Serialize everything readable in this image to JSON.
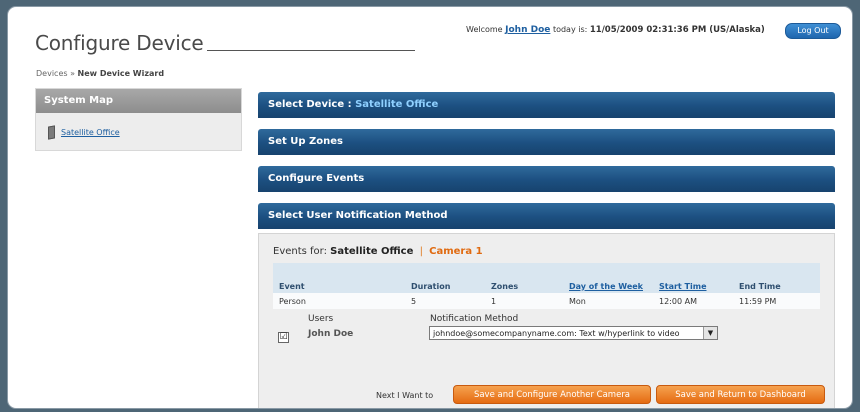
{
  "header": {
    "page_title": "Configure Device",
    "welcome_prefix": "Welcome",
    "user_name": "John Doe",
    "today_is": "today is:",
    "datetime": "11/05/2009 02:31:36 PM (US/Alaska)",
    "logout_label": "Log Out"
  },
  "breadcrumb": {
    "root": "Devices",
    "separator": "»",
    "current": "New Device Wizard"
  },
  "sidebar": {
    "title": "System Map",
    "items": [
      {
        "label": "Satellite Office",
        "icon": "device-icon"
      }
    ]
  },
  "steps": [
    {
      "label": "Select Device :",
      "value": "Satellite Office"
    },
    {
      "label": "Set Up Zones"
    },
    {
      "label": "Configure Events"
    },
    {
      "label": "Select User Notification Method"
    }
  ],
  "panel": {
    "events_for_label": "Events for:",
    "location": "Satellite Office",
    "separator": "|",
    "camera": "Camera 1",
    "table": {
      "columns": [
        "Event",
        "Duration",
        "Zones",
        "Day of the Week",
        "Start Time",
        "End Time"
      ],
      "rows": [
        [
          "Person",
          "5",
          "1",
          "Mon",
          "12:00 AM",
          "11:59 PM"
        ]
      ]
    },
    "users_label": "Users",
    "notification_label": "Notification Method",
    "user": {
      "checked": true,
      "check_glyph": "☑",
      "name": "John Doe"
    },
    "notification_value": "johndoe@somecompanyname.com: Text w/hyperlink to video",
    "next_label": "Next I Want to",
    "btn_another": "Save and Configure Another Camera",
    "btn_dashboard": "Save and Return to Dashboard"
  },
  "colors": {
    "accent_blue": "#1c4f80",
    "highlight": "#8fd0ff",
    "orange": "#e56b12",
    "link": "#1e5fa0"
  }
}
